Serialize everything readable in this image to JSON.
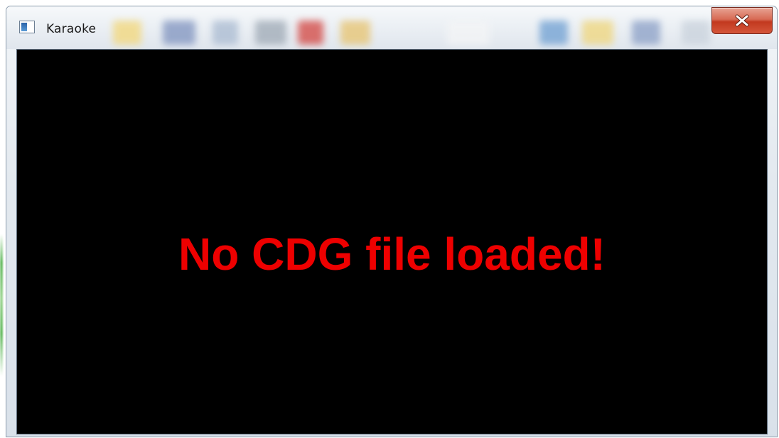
{
  "window": {
    "title": "Karaoke",
    "icon": "application-window-icon",
    "controls": {
      "close_icon": "close-x-icon",
      "close_color": "#c2391f"
    }
  },
  "content": {
    "message": "No CDG file loaded!",
    "message_color": "#ee0000",
    "background_color": "#000000"
  }
}
